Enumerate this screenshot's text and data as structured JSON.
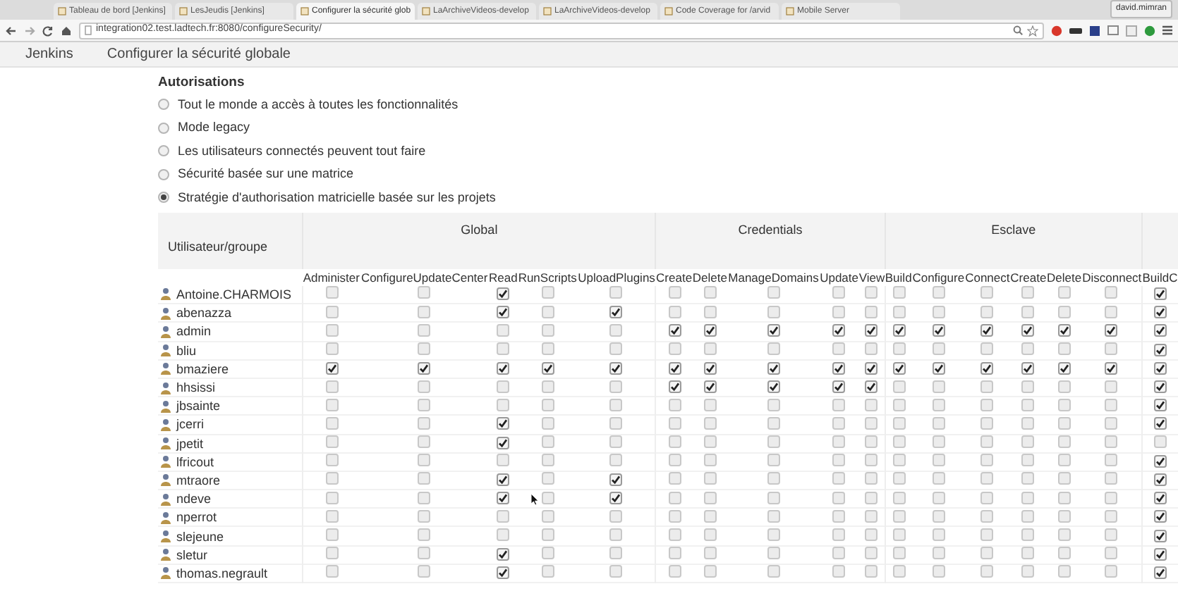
{
  "browser": {
    "tabs": [
      {
        "title": "Tableau de bord [Jenkins]",
        "selected": false
      },
      {
        "title": "LesJeudis [Jenkins]",
        "selected": false
      },
      {
        "title": "Configurer la sécurité glob",
        "selected": true
      },
      {
        "title": "LaArchiveVideos-develop",
        "selected": false
      },
      {
        "title": "LaArchiveVideos-develop",
        "selected": false
      },
      {
        "title": "Code Coverage for /arvid",
        "selected": false
      },
      {
        "title": "Mobile Server",
        "selected": false
      }
    ],
    "user": "david.mimran",
    "url": "integration02.test.ladtech.fr:8080/configureSecurity/"
  },
  "breadcrumbs": [
    "Jenkins",
    "Configurer la sécurité globale"
  ],
  "section_title": "Autorisations",
  "options": [
    {
      "label": "Tout le monde a accès à toutes les fonctionnalités",
      "selected": false
    },
    {
      "label": "Mode legacy",
      "selected": false
    },
    {
      "label": "Les utilisateurs connectés peuvent tout faire",
      "selected": false
    },
    {
      "label": "Sécurité basée sur une matrice",
      "selected": false
    },
    {
      "label": "Stratégie d'authorisation matricielle basée sur les projets",
      "selected": true
    }
  ],
  "matrix": {
    "user_heading": "Utilisateur/groupe",
    "groups": [
      {
        "name": "Global",
        "permissions": [
          "Administer",
          "ConfigureUpdateCenter",
          "Read",
          "RunScripts",
          "UploadPlugins"
        ]
      },
      {
        "name": "Credentials",
        "permissions": [
          "Create",
          "Delete",
          "ManageDomains",
          "Update",
          "View"
        ]
      },
      {
        "name": "Esclave",
        "permissions": [
          "Build",
          "Configure",
          "Connect",
          "Create",
          "Delete",
          "Disconnect"
        ]
      },
      {
        "permissions": [
          "BuildC"
        ]
      }
    ],
    "rows": [
      {
        "name": "Antoine.CHARMOIS",
        "checks": [
          false,
          false,
          true,
          false,
          false,
          false,
          false,
          false,
          false,
          false,
          false,
          false,
          false,
          false,
          false,
          false,
          true
        ]
      },
      {
        "name": "abenazza",
        "checks": [
          false,
          false,
          true,
          false,
          true,
          false,
          false,
          false,
          false,
          false,
          false,
          false,
          false,
          false,
          false,
          false,
          true
        ]
      },
      {
        "name": "admin",
        "checks": [
          false,
          false,
          false,
          false,
          false,
          true,
          true,
          true,
          true,
          true,
          true,
          true,
          true,
          true,
          true,
          true,
          true
        ]
      },
      {
        "name": "bliu",
        "checks": [
          false,
          false,
          false,
          false,
          false,
          false,
          false,
          false,
          false,
          false,
          false,
          false,
          false,
          false,
          false,
          false,
          true
        ]
      },
      {
        "name": "bmaziere",
        "checks": [
          true,
          true,
          true,
          true,
          true,
          true,
          true,
          true,
          true,
          true,
          true,
          true,
          true,
          true,
          true,
          true,
          true
        ]
      },
      {
        "name": "hhsissi",
        "checks": [
          false,
          false,
          false,
          false,
          false,
          true,
          true,
          true,
          true,
          true,
          false,
          false,
          false,
          false,
          false,
          false,
          true
        ]
      },
      {
        "name": "jbsainte",
        "checks": [
          false,
          false,
          false,
          false,
          false,
          false,
          false,
          false,
          false,
          false,
          false,
          false,
          false,
          false,
          false,
          false,
          true
        ]
      },
      {
        "name": "jcerri",
        "checks": [
          false,
          false,
          true,
          false,
          false,
          false,
          false,
          false,
          false,
          false,
          false,
          false,
          false,
          false,
          false,
          false,
          true
        ]
      },
      {
        "name": "jpetit",
        "checks": [
          false,
          false,
          true,
          false,
          false,
          false,
          false,
          false,
          false,
          false,
          false,
          false,
          false,
          false,
          false,
          false,
          false
        ]
      },
      {
        "name": "lfricout",
        "checks": [
          false,
          false,
          false,
          false,
          false,
          false,
          false,
          false,
          false,
          false,
          false,
          false,
          false,
          false,
          false,
          false,
          true
        ]
      },
      {
        "name": "mtraore",
        "checks": [
          false,
          false,
          true,
          false,
          true,
          false,
          false,
          false,
          false,
          false,
          false,
          false,
          false,
          false,
          false,
          false,
          true
        ]
      },
      {
        "name": "ndeve",
        "checks": [
          false,
          false,
          true,
          false,
          true,
          false,
          false,
          false,
          false,
          false,
          false,
          false,
          false,
          false,
          false,
          false,
          true
        ]
      },
      {
        "name": "nperrot",
        "checks": [
          false,
          false,
          false,
          false,
          false,
          false,
          false,
          false,
          false,
          false,
          false,
          false,
          false,
          false,
          false,
          false,
          true
        ]
      },
      {
        "name": "slejeune",
        "checks": [
          false,
          false,
          false,
          false,
          false,
          false,
          false,
          false,
          false,
          false,
          false,
          false,
          false,
          false,
          false,
          false,
          true
        ]
      },
      {
        "name": "sletur",
        "checks": [
          false,
          false,
          true,
          false,
          false,
          false,
          false,
          false,
          false,
          false,
          false,
          false,
          false,
          false,
          false,
          false,
          true
        ]
      },
      {
        "name": "thomas.negrault",
        "checks": [
          false,
          false,
          true,
          false,
          false,
          false,
          false,
          false,
          false,
          false,
          false,
          false,
          false,
          false,
          false,
          false,
          true
        ]
      }
    ]
  }
}
